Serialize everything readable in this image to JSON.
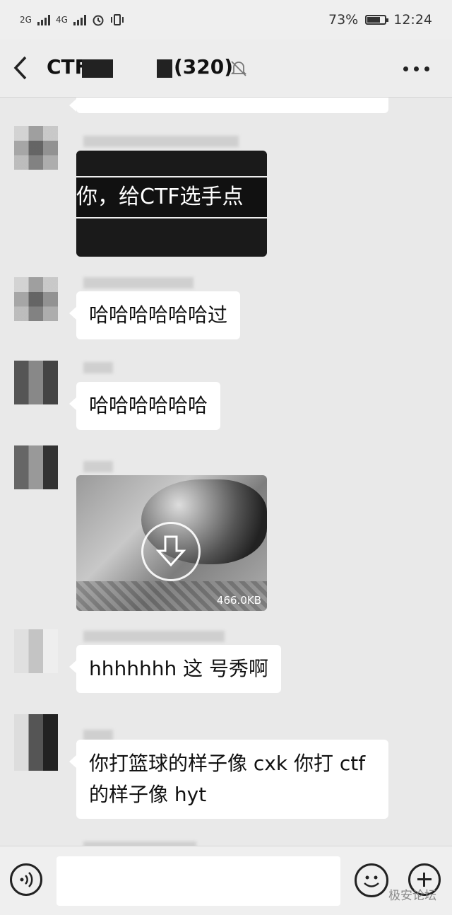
{
  "status_bar": {
    "net1": "2G",
    "net2": "4G",
    "battery": "73%",
    "battery_level": 0.73,
    "time": "12:24"
  },
  "nav": {
    "title_prefix": "CTF",
    "count": "(320)"
  },
  "messages": [
    {
      "type": "image_text",
      "text": "你，给CTF选手点"
    },
    {
      "type": "text",
      "text": "哈哈哈哈哈哈过"
    },
    {
      "type": "text",
      "text": "哈哈哈哈哈哈"
    },
    {
      "type": "image",
      "size": "466.0KB"
    },
    {
      "type": "text",
      "text": "hhhhhhh 这 号秀啊"
    },
    {
      "type": "text",
      "text": "你打篮球的样子像 cxk 你打 ctf 的样子像 hyt"
    }
  ],
  "watermark": "极安论坛",
  "icons": {
    "back": "chevron-left-icon",
    "mute": "bell-off-icon",
    "more": "more-dots-icon",
    "voice": "voice-icon",
    "emoji": "emoji-icon",
    "plus": "plus-icon",
    "download": "download-icon"
  }
}
